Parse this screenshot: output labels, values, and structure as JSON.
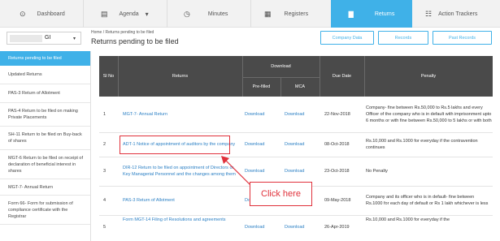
{
  "nav": {
    "items": [
      {
        "label": "Dashboard",
        "icon": "dashboard-icon",
        "glyph": "⊙"
      },
      {
        "label": "Agenda",
        "icon": "agenda-icon",
        "glyph": "▤",
        "caret": "▾"
      },
      {
        "label": "Minutes",
        "icon": "clock-icon",
        "glyph": "◷"
      },
      {
        "label": "Registers",
        "icon": "registers-icon",
        "glyph": "▦"
      },
      {
        "label": "Returns",
        "icon": "document-icon",
        "glyph": "▇"
      },
      {
        "label": "Action Trackers",
        "icon": "tracker-icon",
        "glyph": "☷"
      }
    ],
    "active": "Returns",
    "active_color": "#3fb1e8"
  },
  "company": {
    "value": "GI",
    "caret": "▾"
  },
  "breadcrumb": "Home  /  Returns pending to be filed",
  "page_title": "Returns pending to be filed",
  "header_buttons": {
    "company_data": "Company Data",
    "records": "Records",
    "past_records": "Past Records"
  },
  "sidebar": {
    "items": [
      "Returns pending to be filed",
      "Updated Returns",
      "PAS-3 Return of Allotment",
      "PAS-4 Return to be filed on making Private Placements",
      "SH-11 Return to be filed on Buy-back of shares",
      "MGT-6 Return to be filed on receipt of declaration of beneficial interest in shares",
      "MGT-7- Annual Return",
      "Form 66- Form for submission of compliance certificate with the Registrar"
    ]
  },
  "table": {
    "headers": {
      "sl_no": "Sl No",
      "returns": "Returns",
      "download": "Download",
      "prefilled": "Pre-filled",
      "mca": "MCA",
      "due_date": "Due Date",
      "penalty": "Penalty"
    },
    "rows": [
      {
        "sl": "1",
        "ret": "MGT-7- Annual Return",
        "prefilled": "Download",
        "mca": "Download",
        "due": "22-Nov-2018",
        "penalty": "Company- fine between Rs.50,000 to Rs.5 lakhs and every Officer of the company who is in default with imprisonment upto 6 months or with fine between Rs.50,000 to 5 lakhs or with both"
      },
      {
        "sl": "2",
        "ret": "ADT-1 Notice of appointment of auditors by the company",
        "prefilled": "Download",
        "mca": "Download",
        "due": "08-Oct-2018",
        "penalty": "Rs.10,000 and Rs.1000 for everyday if the contravention continues"
      },
      {
        "sl": "3",
        "ret": "DIR-12 Return to be filed on appointment of Directors or Key Managerial Personnel and the changes among them",
        "prefilled": "Download",
        "mca": "Download",
        "due": "23-Oct-2018",
        "penalty": "No Penalty"
      },
      {
        "sl": "4",
        "ret": "PAS-3 Return of Allotment",
        "prefilled": "Download",
        "mca": "Download",
        "due": "09-May-2018",
        "penalty": "Company and its officer who is in default- fine between Rs.1000 for each day of default or Rs 1 lakh whichever is less"
      },
      {
        "sl": "5",
        "ret": "Form MGT-14 Filing of Resolutions and agreements",
        "prefilled": "Download",
        "mca": "Download",
        "due": "26-Apr-2019",
        "penalty": "Rs.10,000 and Rs.1000 for everyday if the"
      }
    ]
  },
  "annotation": {
    "callout": "Click here",
    "color": "#e0313b"
  }
}
